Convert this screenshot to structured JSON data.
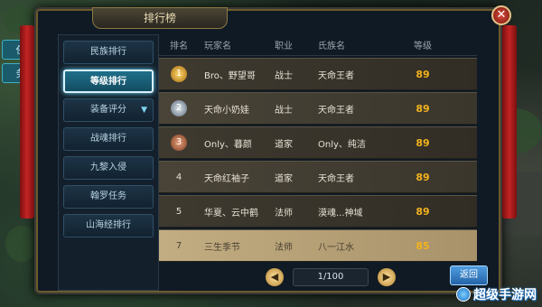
{
  "hud": {
    "left_items": [
      "任",
      "务"
    ]
  },
  "window": {
    "title": "排行榜",
    "close_glyph": "✕"
  },
  "sidebar": {
    "items": [
      {
        "label": "民族排行",
        "active": false
      },
      {
        "label": "等级排行",
        "active": true
      },
      {
        "label": "装备评分",
        "active": false,
        "chevron": "▼"
      },
      {
        "label": "战魂排行",
        "active": false
      },
      {
        "label": "九黎入侵",
        "active": false
      },
      {
        "label": "翰罗任务",
        "active": false
      },
      {
        "label": "山海经排行",
        "active": false
      }
    ]
  },
  "table": {
    "headers": {
      "rank": "排名",
      "name": "玩家名",
      "job": "职业",
      "guild": "氏族名",
      "level": "等级"
    },
    "rows": [
      {
        "rank": "1",
        "medal": "gold",
        "name": "Bro、野望哥",
        "job": "战士",
        "guild": "天命王者",
        "level": "89"
      },
      {
        "rank": "2",
        "medal": "silver",
        "name": "天命小奶娃",
        "job": "战士",
        "guild": "天命王者",
        "level": "89"
      },
      {
        "rank": "3",
        "medal": "bronze",
        "name": "Only、暮颜",
        "job": "道家",
        "guild": "Only、纯洁",
        "level": "89"
      },
      {
        "rank": "4",
        "medal": "",
        "name": "天命红袖子",
        "job": "道家",
        "guild": "天命王者",
        "level": "89"
      },
      {
        "rank": "5",
        "medal": "",
        "name": "华夏、云中鹤",
        "job": "法师",
        "guild": "漠魂...神域",
        "level": "89"
      },
      {
        "rank": "7",
        "medal": "",
        "name": "三生季节",
        "job": "法师",
        "guild": "八一江水",
        "level": "85",
        "self": true
      }
    ]
  },
  "pager": {
    "prev": "◀",
    "next": "▶",
    "page": "1/100"
  },
  "back_button": {
    "label": "返回"
  },
  "watermark": {
    "text": "超级手游网"
  }
}
